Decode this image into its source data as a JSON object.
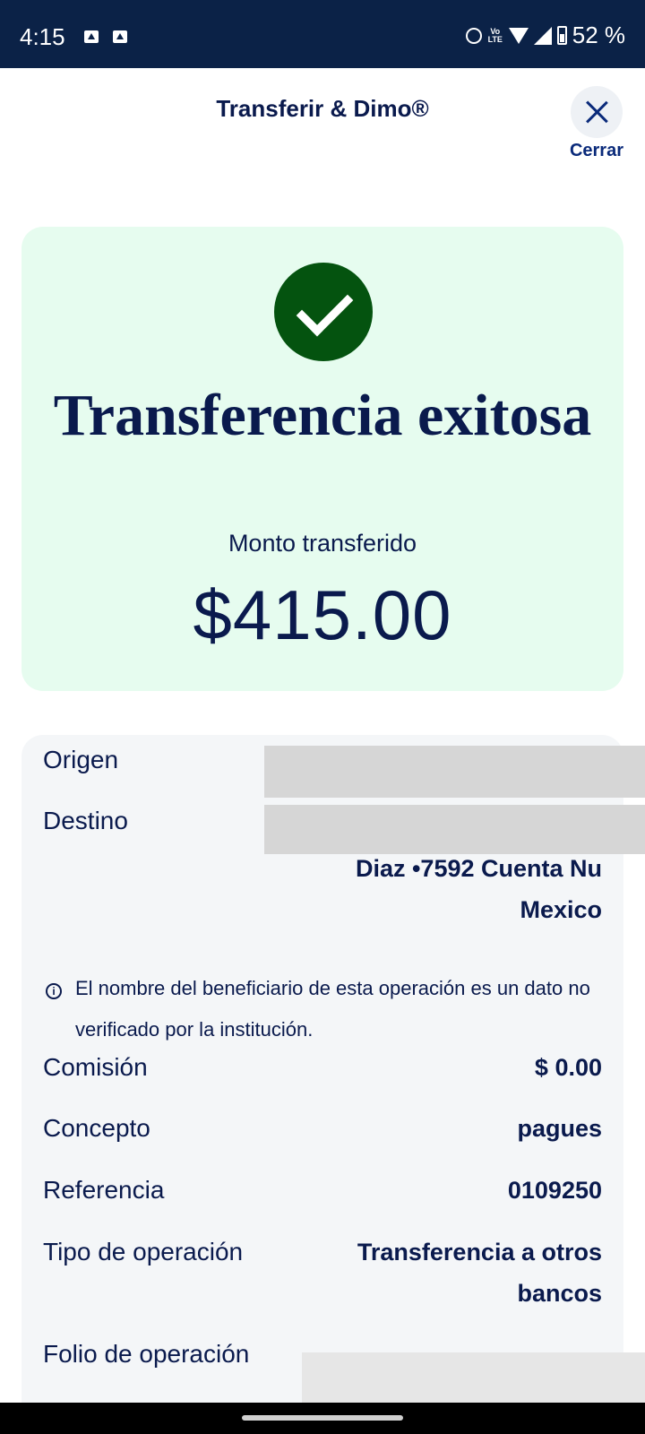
{
  "status_bar": {
    "time": "4:15",
    "volte": "Vo LTE",
    "battery_text": "52 %"
  },
  "header": {
    "title": "Transferir & Dimo®",
    "close_label": "Cerrar"
  },
  "success": {
    "title": "Transferencia exitosa",
    "amount_label": "Monto transferido",
    "amount": "$415.00",
    "colors": {
      "card_bg": "#e6fcef",
      "check_bg": "#04530f"
    }
  },
  "details": {
    "origen_label": "Origen",
    "destino_label": "Destino",
    "destino_value": "Diaz •7592 Cuenta Nu Mexico",
    "note": "El nombre del beneficiario de esta operación es un dato no verificado por la institución.",
    "comision_label": "Comisión",
    "comision_value": "$ 0.00",
    "concepto_label": "Concepto",
    "concepto_value": "pagues",
    "referencia_label": "Referencia",
    "referencia_value": "0109250",
    "tipo_label": "Tipo de operación",
    "tipo_value": "Transferencia a otros bancos",
    "folio_label": "Folio de operación"
  },
  "icons": [
    "alarm-icon",
    "wifi-icon",
    "signal-icon",
    "battery-icon",
    "close-icon",
    "check-icon",
    "info-icon"
  ]
}
